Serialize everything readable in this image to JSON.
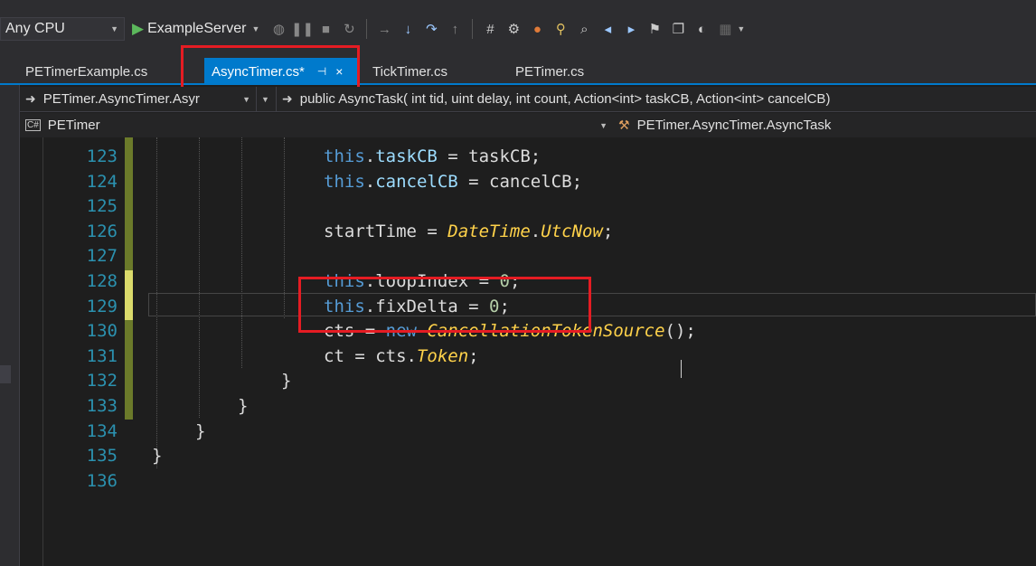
{
  "toolbar": {
    "platform": "Any CPU",
    "run_target": "ExampleServer"
  },
  "tabs": [
    {
      "label": "PETimerExample.cs"
    },
    {
      "label": "AsyncTimer.cs*",
      "pin": "⊣",
      "close": "×"
    },
    {
      "label": "TickTimer.cs"
    },
    {
      "label": "PETimer.cs"
    }
  ],
  "nav": {
    "type_path": "PETimer.AsyncTimer.Asyr",
    "member_signature": "public AsyncTask( int tid, uint delay, int count, Action<int> taskCB, Action<int> cancelCB)",
    "project": "PETimer",
    "scope_path": "PETimer.AsyncTimer.AsyncTask"
  },
  "editor": {
    "line_numbers": [
      "123",
      "124",
      "125",
      "126",
      "127",
      "128",
      "129",
      "130",
      "131",
      "132",
      "133",
      "134",
      "135",
      "136"
    ],
    "lines": {
      "l123": {
        "a": "this",
        "b": ".",
        "c": "taskCB",
        "d": " = taskCB;"
      },
      "l124": {
        "a": "this",
        "b": ".",
        "c": "cancelCB",
        "d": " = cancelCB;"
      },
      "l126": {
        "a": "startTime = ",
        "b": "DateTime",
        "c": ".",
        "d": "UtcNow",
        "e": ";"
      },
      "l128": {
        "a": "this",
        "b": ".loopIndex = ",
        "c": "0",
        "d": ";"
      },
      "l129": {
        "a": "this",
        "b": ".fixDelta = ",
        "c": "0",
        "d": ";"
      },
      "l130": {
        "a": "cts = ",
        "b": "new",
        "c": " ",
        "d": "CancellationTokenSource",
        "e": "();"
      },
      "l131": {
        "a": "ct = cts.",
        "b": "Token",
        "c": ";"
      },
      "l132": "}",
      "l133": "}",
      "l134": "}",
      "l135": "}"
    }
  },
  "colors": {
    "accent_tab": "#007acc",
    "annotation_box": "#e51c23",
    "keyword": "#569cd6",
    "type": "#ffd24a",
    "line_number": "#2b91af"
  }
}
